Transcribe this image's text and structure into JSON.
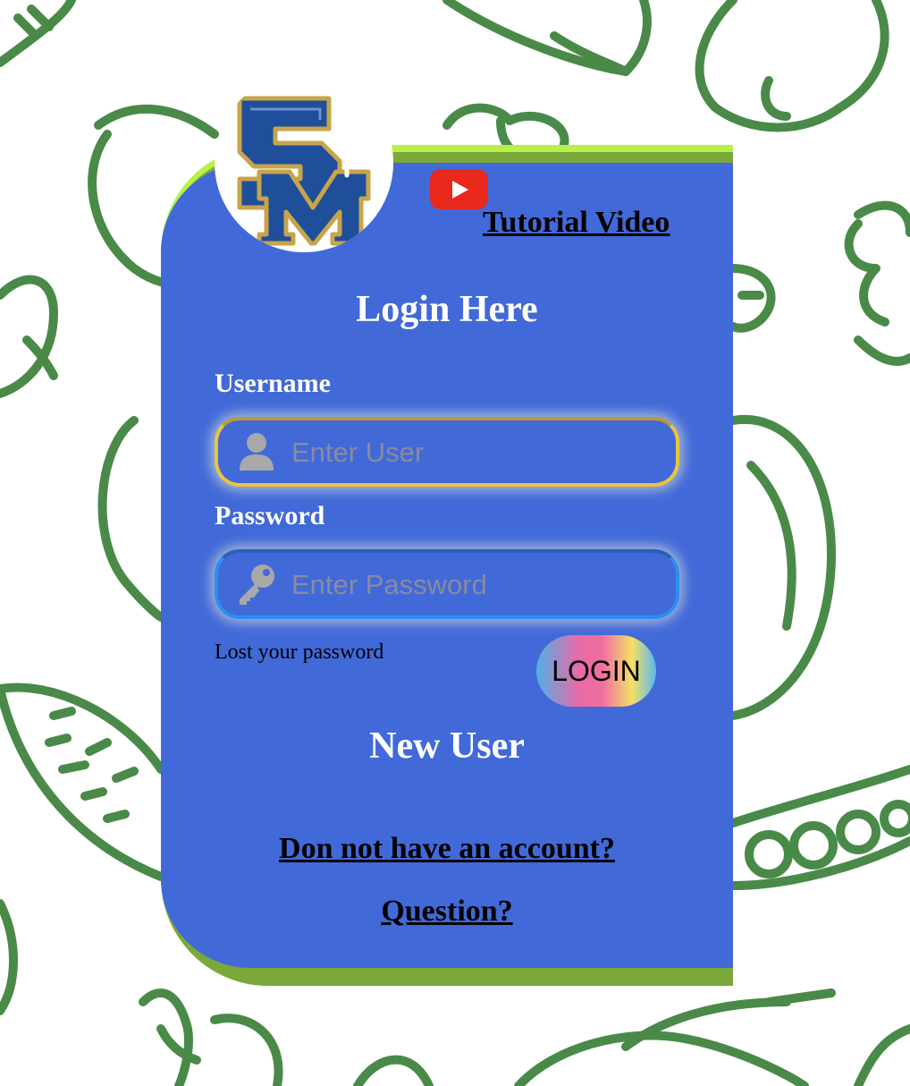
{
  "header": {
    "tutorial_label": "Tutorial Video"
  },
  "form": {
    "title": "Login Here",
    "username_label": "Username",
    "username_placeholder": "Enter User",
    "password_label": "Password",
    "password_placeholder": "Enter Password",
    "lost_password": "Lost your password",
    "login_button": "LOGIN"
  },
  "new_user": {
    "title": "New User",
    "signup_link": "Don not have an account?",
    "question_link": "Question?"
  },
  "colors": {
    "card": "#4169d8",
    "card_border": "#b7f04a",
    "background_doodle": "#4a8a48",
    "logo_blue": "#1f4f9a",
    "logo_gold": "#c8a44a",
    "youtube_red": "#e8291c"
  },
  "icons": {
    "logo": "school-monogram-logo",
    "tutorial": "youtube-play-icon",
    "username": "user-icon",
    "password": "key-icon"
  }
}
